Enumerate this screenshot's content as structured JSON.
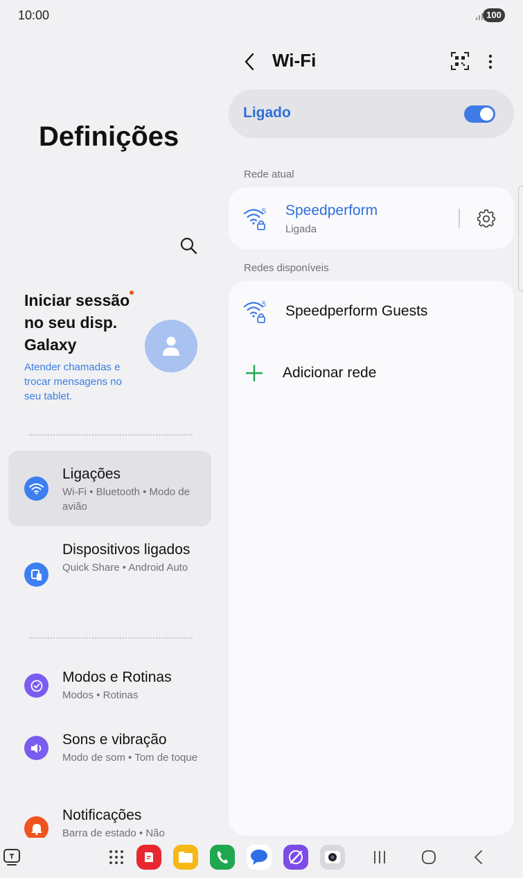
{
  "status_bar": {
    "time": "10:00",
    "battery": "100"
  },
  "settings": {
    "title": "Definições",
    "account": {
      "title": "Iniciar sessão no seu disp. Galaxy",
      "subtitle": "Atender chamadas e trocar mensagens no seu tablet."
    },
    "items": [
      {
        "label": "Ligações",
        "sub": "Wi-Fi  •  Bluetooth  •  Modo de avião",
        "icon": "wifi-icon",
        "color": "#3d7ff0",
        "selected": true
      },
      {
        "label": "Dispositivos ligados",
        "sub": "Quick Share  •  Android Auto",
        "icon": "devices-icon",
        "color": "#3d7ff0"
      },
      {
        "label": "Modos e Rotinas",
        "sub": "Modos  •  Rotinas",
        "icon": "check-circle-icon",
        "color": "#7a5cf0"
      },
      {
        "label": "Sons e vibração",
        "sub": "Modo de som  •  Tom de toque",
        "icon": "volume-icon",
        "color": "#7a5cf0"
      },
      {
        "label": "Notificações",
        "sub": "Barra de estado  •  Não",
        "icon": "bell-icon",
        "color": "#f0541e"
      }
    ]
  },
  "wifi": {
    "title": "Wi-Fi",
    "toggle_label": "Ligado",
    "toggle_on": true,
    "current_section": "Rede atual",
    "current_network": {
      "name": "Speedperform",
      "status": "Ligada",
      "band": "5"
    },
    "available_section": "Redes disponíveis",
    "available_networks": [
      {
        "name": "Speedperform Guests",
        "band": "5"
      }
    ],
    "add_network": "Adicionar rede"
  },
  "colors": {
    "accent": "#3e7be6",
    "add_green": "#1fa84f"
  },
  "dock": [
    {
      "name": "app-drawer-icon"
    },
    {
      "name": "notes-app-icon",
      "color": "#e8282e"
    },
    {
      "name": "files-app-icon",
      "color": "#f6b818"
    },
    {
      "name": "phone-app-icon",
      "color": "#1fa84f"
    },
    {
      "name": "messages-app-icon",
      "color": "#2f6fe6"
    },
    {
      "name": "internet-app-icon",
      "color": "#7b4de6"
    },
    {
      "name": "camera-app-icon",
      "color": "#b8b8c0"
    }
  ]
}
